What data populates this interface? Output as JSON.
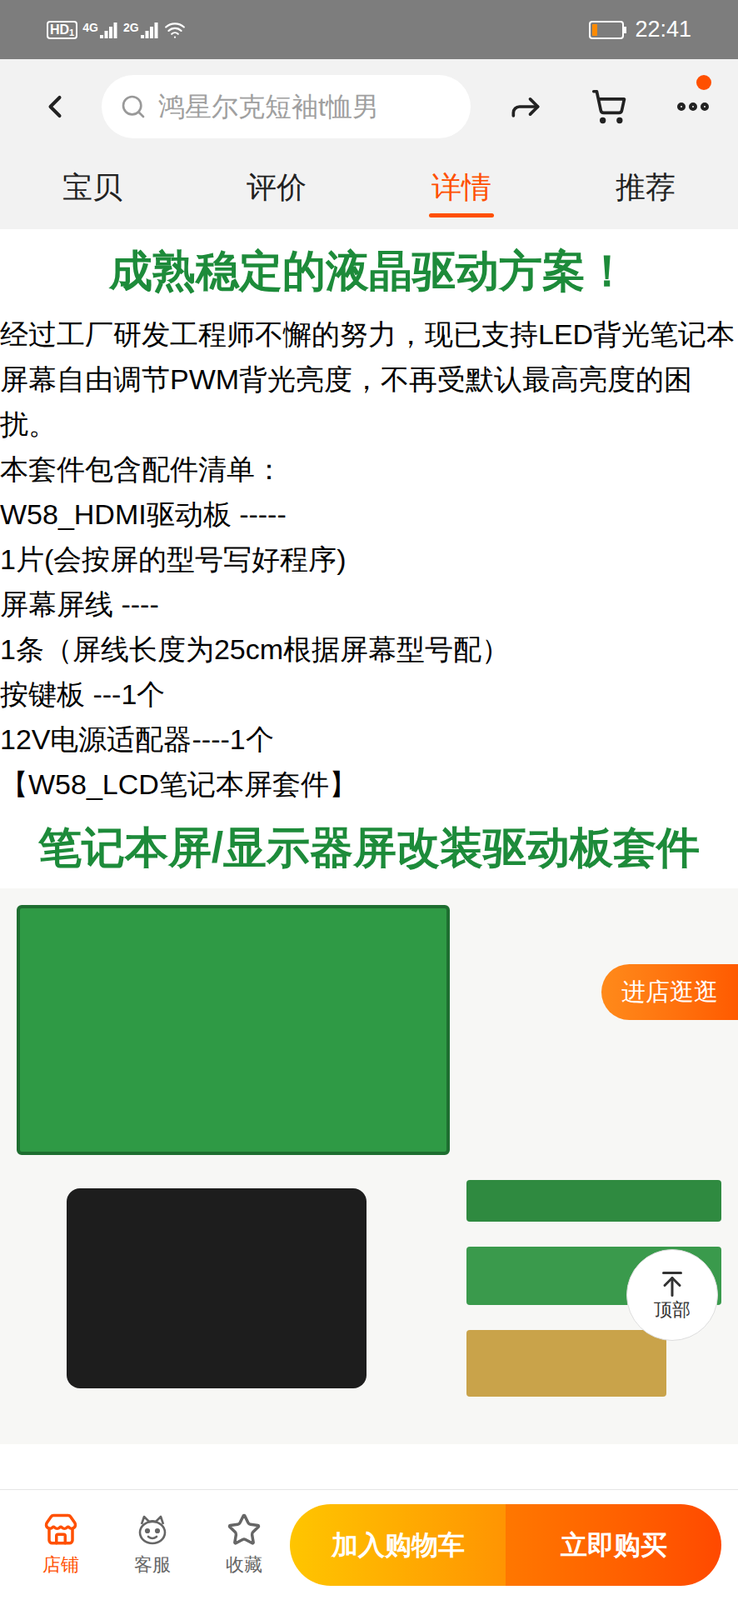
{
  "status_bar": {
    "hd": "HD",
    "sim": "1",
    "networks": [
      "4G",
      "2G"
    ],
    "time": "22:41",
    "battery": {
      "level": 0.15
    }
  },
  "nav": {
    "search_placeholder": "鸿星尔克短袖t恤男",
    "notification_dot": true
  },
  "tabs": [
    {
      "label": "宝贝",
      "selected": false
    },
    {
      "label": "评价",
      "selected": false
    },
    {
      "label": "详情",
      "selected": true
    },
    {
      "label": "推荐",
      "selected": false
    }
  ],
  "detail": {
    "banner_top": "成熟稳定的液晶驱动方案！",
    "paragraphs": [
      "经过工厂研发工程师不懈的努力，现已支持LED背光笔记本屏幕自由调节PWM背光亮度，不再受默认最高亮度的困扰。",
      "本套件包含配件清单：",
      "W58_HDMI驱动板 -----",
      "1片(会按屏的型号写好程序)",
      "屏幕屏线 ----",
      "1条（屏线长度为25cm根据屏幕型号配）",
      "按键板 ---1个",
      "12V电源适配器----1个",
      "【W58_LCD笔记本屏套件】"
    ],
    "banner_kit": "笔记本屏/显示器屏改装驱动板套件"
  },
  "floating": {
    "shop_button": "进店逛逛",
    "top_button": "顶部"
  },
  "bottom_bar": {
    "actions": [
      {
        "label": "店铺",
        "active": true
      },
      {
        "label": "客服",
        "active": false
      },
      {
        "label": "收藏",
        "active": false
      }
    ],
    "buttons": [
      "加入购物车",
      "立即购买"
    ]
  }
}
